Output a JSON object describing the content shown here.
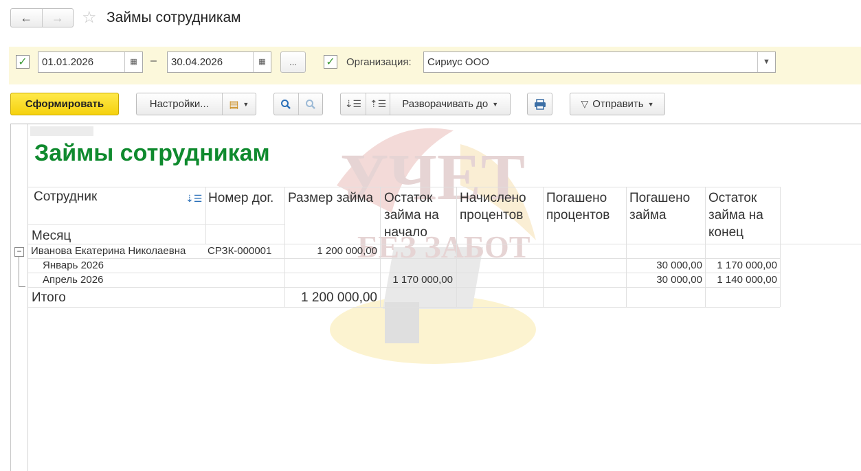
{
  "header": {
    "title": "Займы сотрудникам"
  },
  "filters": {
    "date_from": "01.01.2026",
    "date_to": "30.04.2026",
    "dash": "–",
    "ellipsis": "...",
    "org_label": "Организация:",
    "org_value": "Сириус ООО"
  },
  "toolbar": {
    "generate": "Сформировать",
    "settings": "Настройки...",
    "expand_to": "Разворачивать до",
    "send": "Отправить"
  },
  "report": {
    "title": "Займы сотрудникам",
    "columns": {
      "employee": "Сотрудник",
      "month": "Месяц",
      "contract": "Номер дог.",
      "loan_amount": "Размер займа",
      "balance_start": "Остаток займа на начало",
      "interest_accrued": "Начислено процентов",
      "interest_repaid": "Погашено процентов",
      "loan_repaid": "Погашено займа",
      "balance_end": "Остаток займа на конец"
    },
    "group": {
      "employee": "Иванова Екатерина Николаевна",
      "contract": "СРЗК-000001",
      "loan_amount": "1 200 000,00"
    },
    "rows": [
      {
        "month": "Январь 2026",
        "balance_start": "",
        "loan_repaid": "30 000,00",
        "balance_end": "1 170 000,00"
      },
      {
        "month": "Апрель 2026",
        "balance_start": "1 170 000,00",
        "loan_repaid": "30 000,00",
        "balance_end": "1 140 000,00"
      }
    ],
    "total": {
      "label": "Итого",
      "loan_amount": "1 200 000,00"
    }
  },
  "watermark": {
    "line1": "УЧЕТ",
    "line2": "БЕЗ ЗАБОТ"
  },
  "colors": {
    "accent_green": "#0f8a2e",
    "primary_button": "#f5d10e",
    "filter_bg": "#fcf8db"
  }
}
